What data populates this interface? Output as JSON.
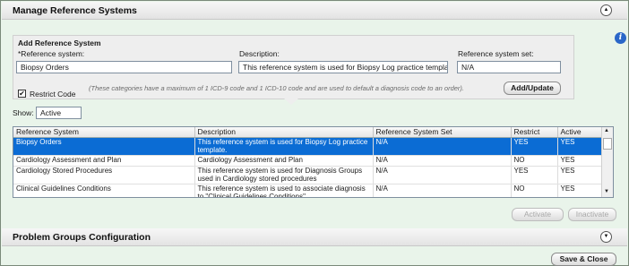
{
  "sections": {
    "reference_systems": {
      "title": "Manage Reference Systems",
      "toggle_icon": "chevron-up-icon",
      "toggle_glyph": "▲"
    },
    "problem_groups": {
      "title": "Problem Groups Configuration",
      "toggle_icon": "chevron-down-icon",
      "toggle_glyph": "▼"
    }
  },
  "info_glyph": "i",
  "add_form": {
    "title": "Add Reference System",
    "reference_system_label": "*Reference system:",
    "reference_system_value": "Biopsy Orders",
    "description_label": "Description:",
    "description_value": "This reference system is used for Biopsy Log practice template.",
    "set_label": "Reference system set:",
    "set_value": "N/A",
    "restrict_label": "Restrict Code",
    "restrict_checked_glyph": "✔",
    "hint": "(These categories have a maximum of 1 ICD-9 code and 1 ICD-10 code and are used to default a diagnosis code to an order).",
    "add_update_label": "Add/Update"
  },
  "show": {
    "label": "Show:",
    "value": "Active"
  },
  "table": {
    "columns": [
      "Reference System",
      "Description",
      "Reference System Set",
      "Restrict",
      "Active"
    ],
    "rows": [
      [
        "Biopsy Orders",
        "This reference system is used for Biopsy Log practice template.",
        "N/A",
        "YES",
        "YES"
      ],
      [
        "Cardiology Assessment and Plan",
        "Cardiology Assessment and Plan",
        "N/A",
        "NO",
        "YES"
      ],
      [
        "Cardiology Stored Procedures",
        "This reference system is used for Diagnosis Groups used in Cardiology stored procedures",
        "N/A",
        "YES",
        "YES"
      ],
      [
        "Clinical Guidelines Conditions",
        "This reference system is used to associate diagnosis to \"Clinical Guidelines Conditions\"",
        "N/A",
        "NO",
        "YES"
      ]
    ],
    "selected_row": 0,
    "scroll_up_glyph": "▲",
    "scroll_down_glyph": "▼"
  },
  "actions": {
    "activate_label": "Activate",
    "inactivate_label": "Inactivate"
  },
  "footer": {
    "save_close_label": "Save & Close"
  },
  "colors": {
    "selection": "#0b6cd4",
    "panel_bg": "#e9f4ea",
    "info": "#2a66c8"
  }
}
